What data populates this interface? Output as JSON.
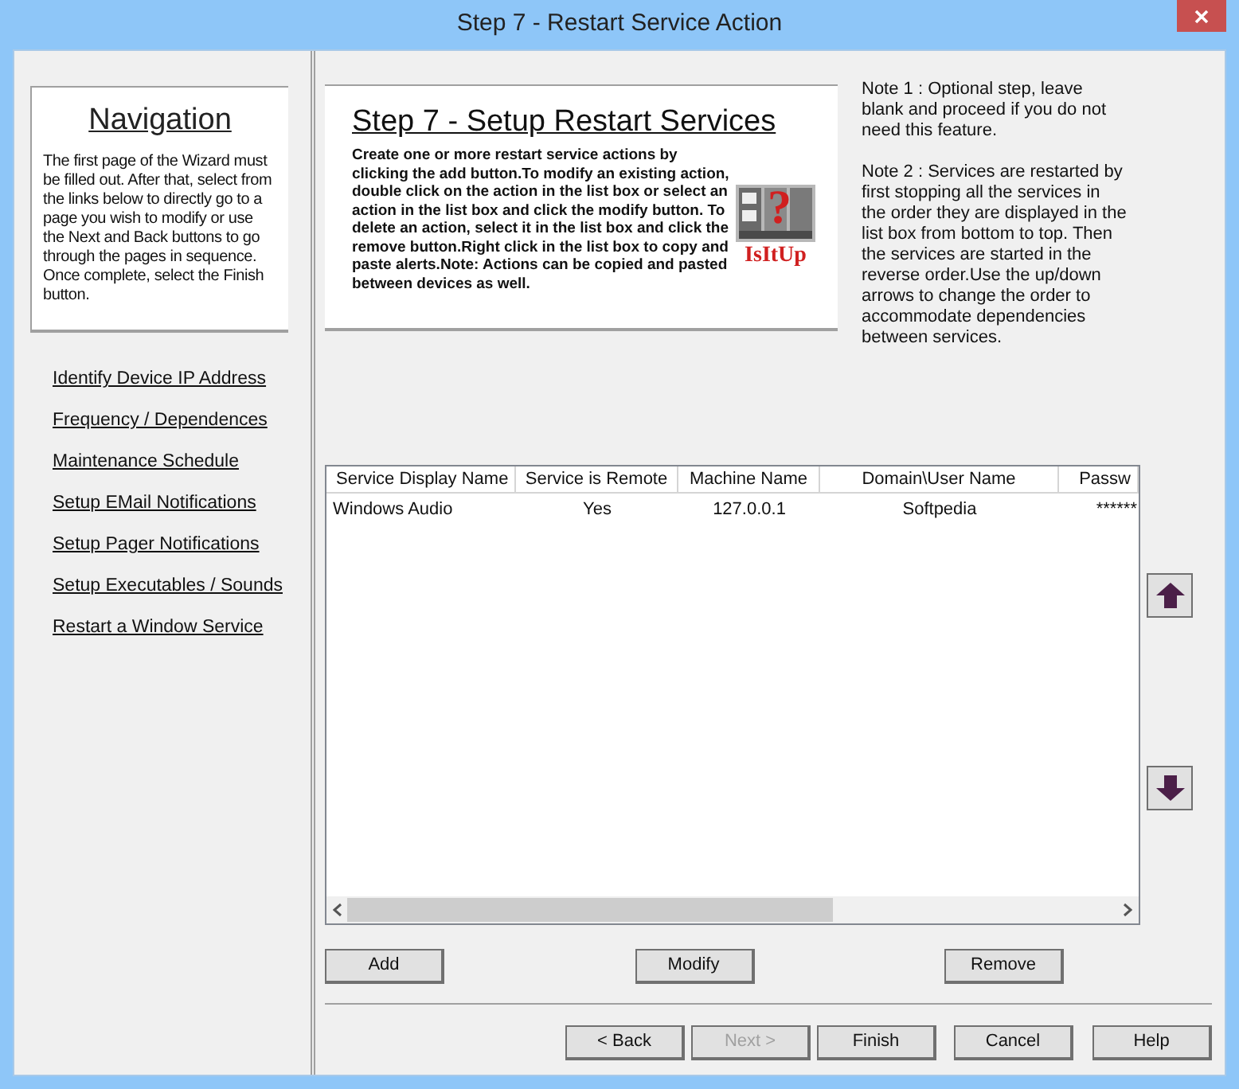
{
  "window": {
    "title": "Step 7 - Restart Service Action"
  },
  "navigation": {
    "title": "Navigation",
    "text": "The first page of the Wizard must be filled out. After that, select from the links below to directly go to a page you wish to modify or use the Next and Back buttons to go through the pages in sequence. Once complete, select the Finish button.",
    "links": [
      "Identify Device IP Address",
      "Frequency / Dependences",
      "Maintenance Schedule",
      "Setup EMail Notifications",
      "Setup Pager Notifications",
      "Setup Executables / Sounds",
      "Restart a Window Service"
    ]
  },
  "header": {
    "title": "Step 7 - Setup Restart Services",
    "text": "Create one or more restart service actions by clicking the add button.To modify an existing action, double click on the action in the list box or select an action in the list box and click the modify button. To delete an action, select it in the list box and click the remove button.Right click in the list box to copy and paste alerts.Note: Actions can be copied and pasted between devices as well.",
    "logo": {
      "mark": "?",
      "text": "IsItUp"
    }
  },
  "notes": [
    "Note 1 : Optional step, leave blank and proceed if you do not need this feature.",
    "Note 2 : Services are restarted by first stopping all the services in the order they are displayed in the list box from bottom to top. Then the services are started in the reverse order.Use the up/down arrows to change the order to accommodate dependencies between services."
  ],
  "table": {
    "columns": [
      "Service Display Name",
      "Service is Remote",
      "Machine Name",
      "Domain\\User Name",
      "Passw"
    ],
    "rows": [
      [
        "Windows Audio",
        "Yes",
        "127.0.0.1",
        "Softpedia",
        "******"
      ]
    ]
  },
  "list_buttons": [
    "Add",
    "Modify",
    "Remove"
  ],
  "wizard_buttons": [
    {
      "label": "< Back",
      "disabled": false
    },
    {
      "label": "Next >",
      "disabled": true
    },
    {
      "label": "Finish",
      "disabled": false
    },
    {
      "label": "Cancel",
      "disabled": false
    },
    {
      "label": "Help",
      "disabled": false
    }
  ]
}
